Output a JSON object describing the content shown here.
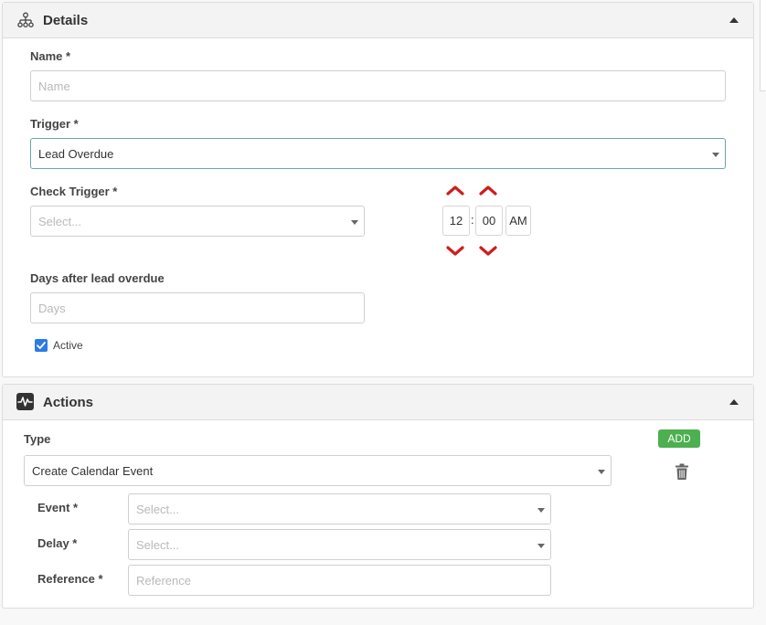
{
  "details": {
    "title": "Details",
    "icon": "sitemap-icon",
    "name_label": "Name *",
    "name_placeholder": "Name",
    "name_value": "",
    "trigger_label": "Trigger *",
    "trigger_value": "Lead Overdue",
    "check_trigger_label": "Check Trigger *",
    "check_trigger_placeholder": "Select...",
    "time": {
      "hour": "12",
      "separator": ":",
      "minute": "00",
      "meridian": "AM"
    },
    "days_label": "Days after lead overdue",
    "days_placeholder": "Days",
    "days_value": "",
    "active_label": "Active",
    "active_checked": true
  },
  "actions": {
    "title": "Actions",
    "icon": "activity-icon",
    "type_label": "Type",
    "add_label": "ADD",
    "type_value": "Create Calendar Event",
    "event_label": "Event *",
    "event_placeholder": "Select...",
    "delay_label": "Delay *",
    "delay_placeholder": "Select...",
    "reference_label": "Reference *",
    "reference_placeholder": "Reference",
    "reference_value": ""
  },
  "colors": {
    "accent_red": "#cc1f1a",
    "add_green": "#4caf50",
    "checkbox_blue": "#2d7be5",
    "focus_border": "#6fa3a8"
  }
}
